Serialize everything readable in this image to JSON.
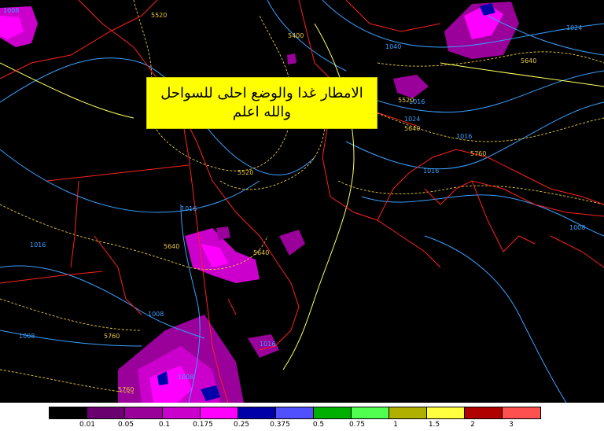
{
  "annotation": {
    "line1": "الامطار غدا والوضع احلى للسواحل",
    "line2": "والله اعلم"
  },
  "isobar_labels": [
    "1008",
    "1016",
    "1016",
    "1016",
    "1016",
    "1008",
    "1008",
    "1008",
    "1008",
    "1040",
    "1024",
    "1024",
    "1016",
    "1016"
  ],
  "height_labels": [
    "5520",
    "5400",
    "5520",
    "5520",
    "5640",
    "5640",
    "5640",
    "5640",
    "5760",
    "5760",
    "5760"
  ],
  "legend": {
    "colors": [
      "#000000",
      "#6a0070",
      "#9a009a",
      "#cc00cc",
      "#ff00ff",
      "#0000a8",
      "#5050ff",
      "#00b000",
      "#50ff50",
      "#b0b000",
      "#ffff40",
      "#b00000",
      "#ff5050"
    ],
    "ticks": [
      "0.01",
      "0.05",
      "0.1",
      "0.175",
      "0.25",
      "0.375",
      "0.5",
      "0.75",
      "1",
      "1.5",
      "2",
      "3"
    ]
  }
}
